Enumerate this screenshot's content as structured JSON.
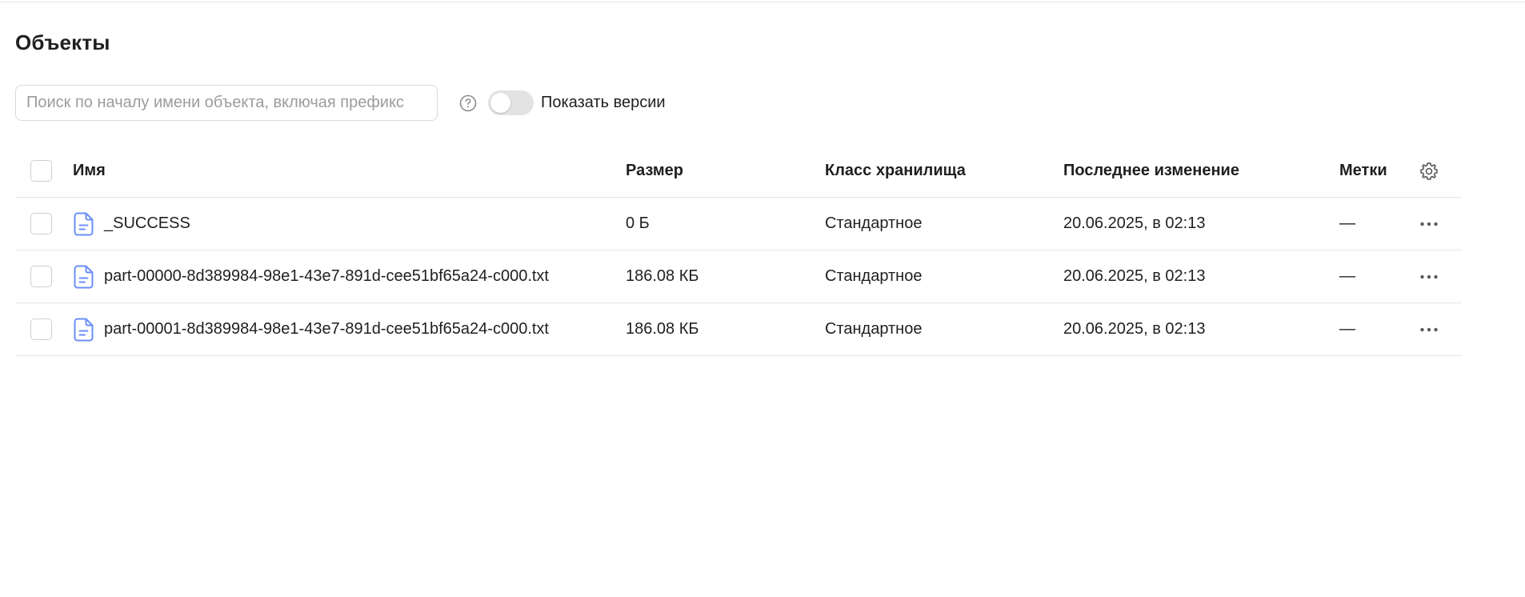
{
  "page": {
    "title": "Объекты"
  },
  "toolbar": {
    "search_placeholder": "Поиск по началу имени объекта, включая префикс",
    "help_icon": "question-circle-icon",
    "versions_toggle_label": "Показать версии",
    "versions_toggle_on": false
  },
  "table": {
    "headers": {
      "name": "Имя",
      "size": "Размер",
      "storage_class": "Класс хранилища",
      "modified": "Последнее изменение",
      "tags": "Метки"
    },
    "settings_icon": "gear-icon",
    "rows": [
      {
        "name": "_SUCCESS",
        "size": "0 Б",
        "storage_class": "Стандартное",
        "modified": "20.06.2025, в 02:13",
        "tags": "—"
      },
      {
        "name": "part-00000-8d389984-98e1-43e7-891d-cee51bf65a24-c000.txt",
        "size": "186.08 КБ",
        "storage_class": "Стандартное",
        "modified": "20.06.2025, в 02:13",
        "tags": "—"
      },
      {
        "name": "part-00001-8d389984-98e1-43e7-891d-cee51bf65a24-c000.txt",
        "size": "186.08 КБ",
        "storage_class": "Стандартное",
        "modified": "20.06.2025, в 02:13",
        "tags": "—"
      }
    ]
  },
  "colors": {
    "file_icon": "#6a8ff7",
    "muted_icon": "#8c8c8c",
    "border": "#e6e6e6",
    "toggle_off": "#e3e3e3"
  }
}
